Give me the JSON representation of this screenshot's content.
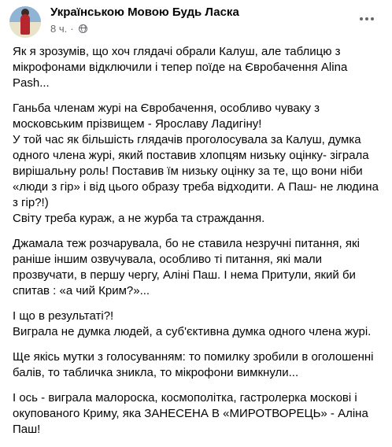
{
  "post": {
    "author": "Українською Мовою Будь Ласка",
    "time": "8 ч.",
    "separator": "·",
    "paragraphs": [
      "Як я зрозумів, що хоч глядачі обрали Калуш, але таблицю з мікрофонами відключили і тепер поїде на Євробачення Alina Pash...",
      "Ганьба членам журі на Євробачення, особливо чуваку з московським прізвищем - Ярославу Ладигіну!\nУ той час як більшість глядачів проголосувала за Калуш, думка одного члена журі, який поставив хлопцям низьку оцінку- зіграла вирішальну роль! Поставив їм низьку оцінку за те, що вони ніби «люди з гір» і від цього образу треба відходити. А Паш- не людина з гір?!)\nСвіту треба кураж, а не журба та страждання.",
      "Джамала теж розчарувала, бо не ставила незручні питання, які раніше іншим озвучувала, особливо ті питання, які мали прозвучати, в першу чергу, Аліні Паш. І нема Притули, який би спитав : «а чий Крим?»...",
      "І що в результаті?!\nВиграла не думка людей, а суб'єктивна думка одного члена журі.",
      "Ще якісь мутки з голосуванням: то помилку зробили в оголошенні балів, то табличка зникла, то мікрофони вимкнули...",
      " І ось - виграла малороска, космополітка, гастролерка москові і окупованого Криму, яка ЗАНЕСЕНА В «МИРОТВОРЕЦЬ» - Аліна Паш!"
    ]
  },
  "icons": {
    "audience": "globe-icon",
    "menu": "more-horizontal-icon"
  },
  "colors": {
    "text": "#050505",
    "secondary": "#65676b"
  }
}
